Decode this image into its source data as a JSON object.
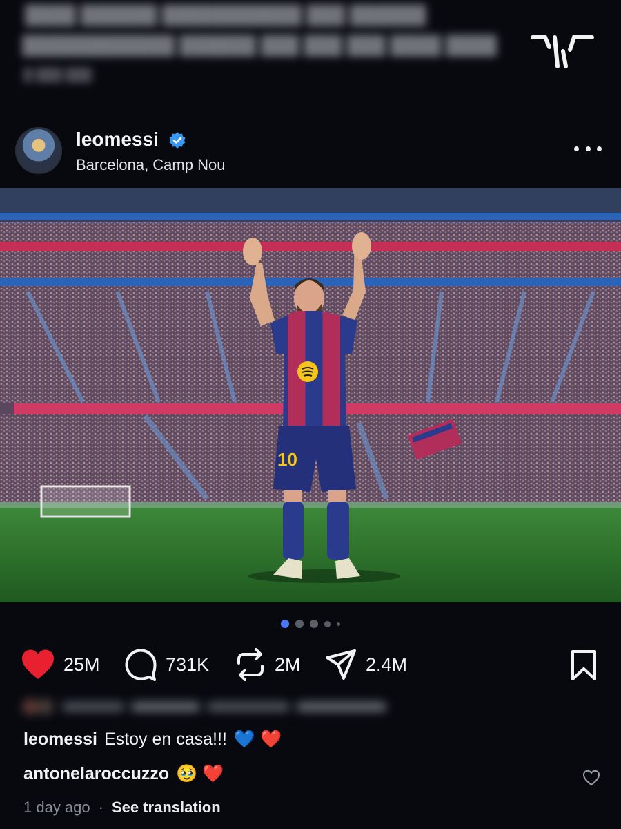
{
  "post": {
    "username": "leomessi",
    "location": "Barcelona, Camp Nou",
    "verified_icon": "verified-badge-icon",
    "more_icon": "more-options-icon"
  },
  "photo": {
    "jersey_number": "10"
  },
  "carousel": {
    "count": 5,
    "active_index": 0
  },
  "actions": {
    "likes": "25M",
    "comments": "731K",
    "reposts": "2M",
    "shares": "2.4M",
    "liked": true
  },
  "captions": [
    {
      "user": "leomessi",
      "text": "Estoy en casa!!!",
      "emoji": "💙 ❤️"
    },
    {
      "user": "antonelaroccuzzo",
      "text": "",
      "emoji": "🥹 ❤️"
    }
  ],
  "meta": {
    "time": "1 day ago",
    "separator": "·",
    "translate": "See translation"
  },
  "colors": {
    "background": "#07090f",
    "like_red": "#e8202f",
    "verified_blue": "#3897f0",
    "dot_active": "#4a78f5",
    "dot_inactive": "#5b5f68"
  }
}
